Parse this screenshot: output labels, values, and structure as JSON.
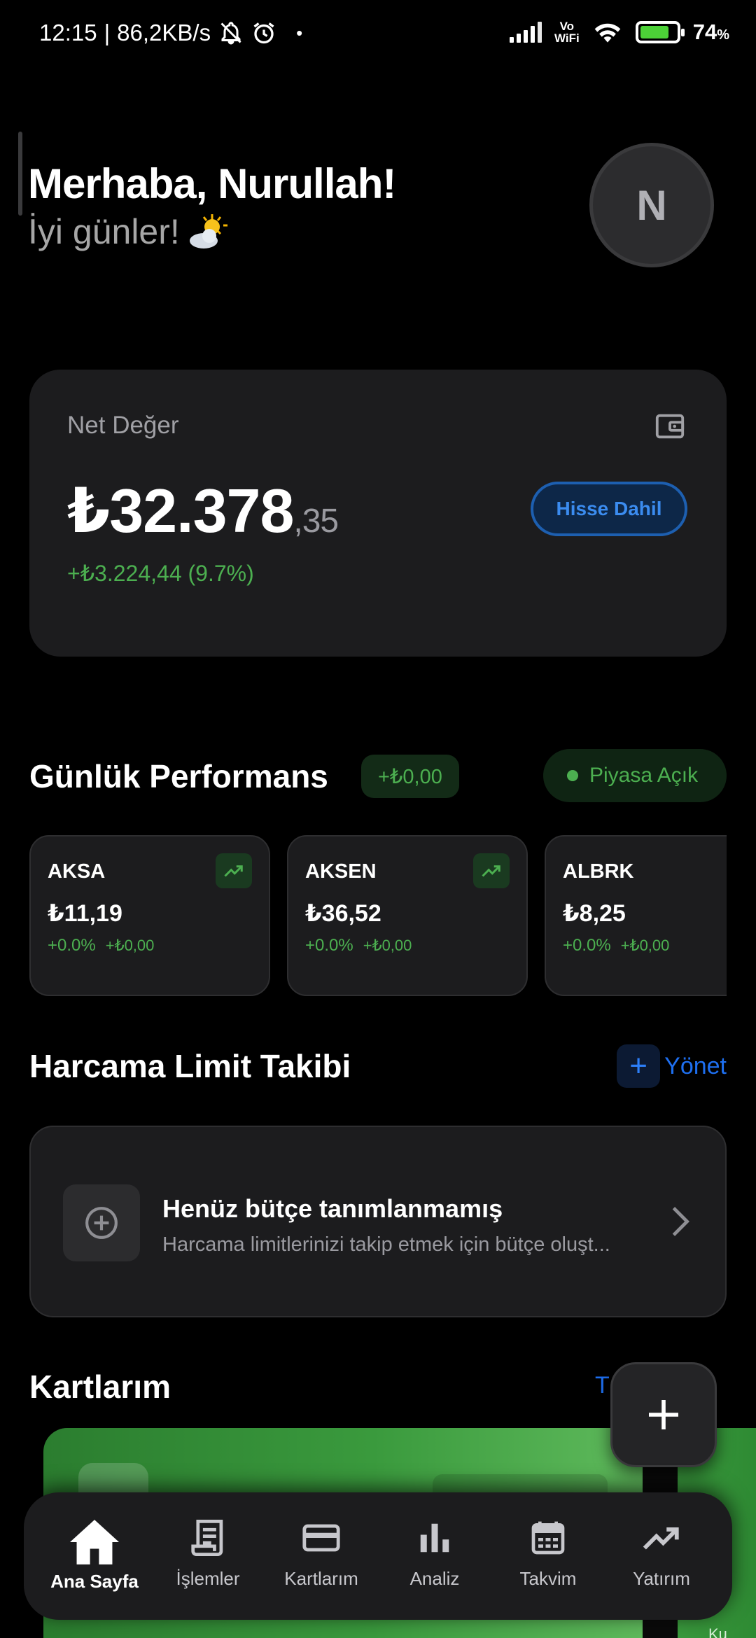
{
  "status_bar": {
    "time": "12:15",
    "speed": "86,2KB/s",
    "network_label_top": "Vo",
    "network_label_bottom": "WiFi",
    "battery_percent": "74",
    "battery_percent_symbol": "%"
  },
  "greeting": {
    "title": "Merhaba, Nurullah!",
    "subtitle": "İyi günler!",
    "avatar_initial": "N"
  },
  "net_worth": {
    "label": "Net Değer",
    "amount_main": "₺32.378",
    "amount_decimal": ",35",
    "change": "+₺3.224,44 (9.7%)",
    "toggle_label": "Hisse Dahil"
  },
  "daily_performance": {
    "title": "Günlük Performans",
    "total_change": "+₺0,00",
    "market_status": "Piyasa Açık",
    "stocks": [
      {
        "symbol": "AKSA",
        "price": "₺11,19",
        "change_pct": "+0.0%",
        "change_abs": "+₺0,00"
      },
      {
        "symbol": "AKSEN",
        "price": "₺36,52",
        "change_pct": "+0.0%",
        "change_abs": "+₺0,00"
      },
      {
        "symbol": "ALBRK",
        "price": "₺8,25",
        "change_pct": "+0.0%",
        "change_abs": "+₺0,00"
      }
    ]
  },
  "spending_limits": {
    "title": "Harcama Limit Takibi",
    "manage_label": "Yönet",
    "empty_title": "Henüz bütçe tanımlanmamış",
    "empty_subtitle": "Harcama limitlerinizi takip etmek için bütçe oluşt..."
  },
  "cards": {
    "title": "Kartlarım",
    "see_all": "T           r",
    "second_card_text": "Ku"
  },
  "bottom_nav": {
    "items": [
      {
        "label": "Ana Sayfa",
        "icon": "home-icon"
      },
      {
        "label": "İşlemler",
        "icon": "receipt-icon"
      },
      {
        "label": "Kartlarım",
        "icon": "credit-card-icon"
      },
      {
        "label": "Analiz",
        "icon": "bar-chart-icon"
      },
      {
        "label": "Takvim",
        "icon": "calendar-icon"
      },
      {
        "label": "Yatırım",
        "icon": "trending-up-icon"
      }
    ]
  },
  "colors": {
    "background": "#000000",
    "card": "#1c1c1e",
    "positive": "#4caf50",
    "accent_blue": "#1e6ff0"
  }
}
